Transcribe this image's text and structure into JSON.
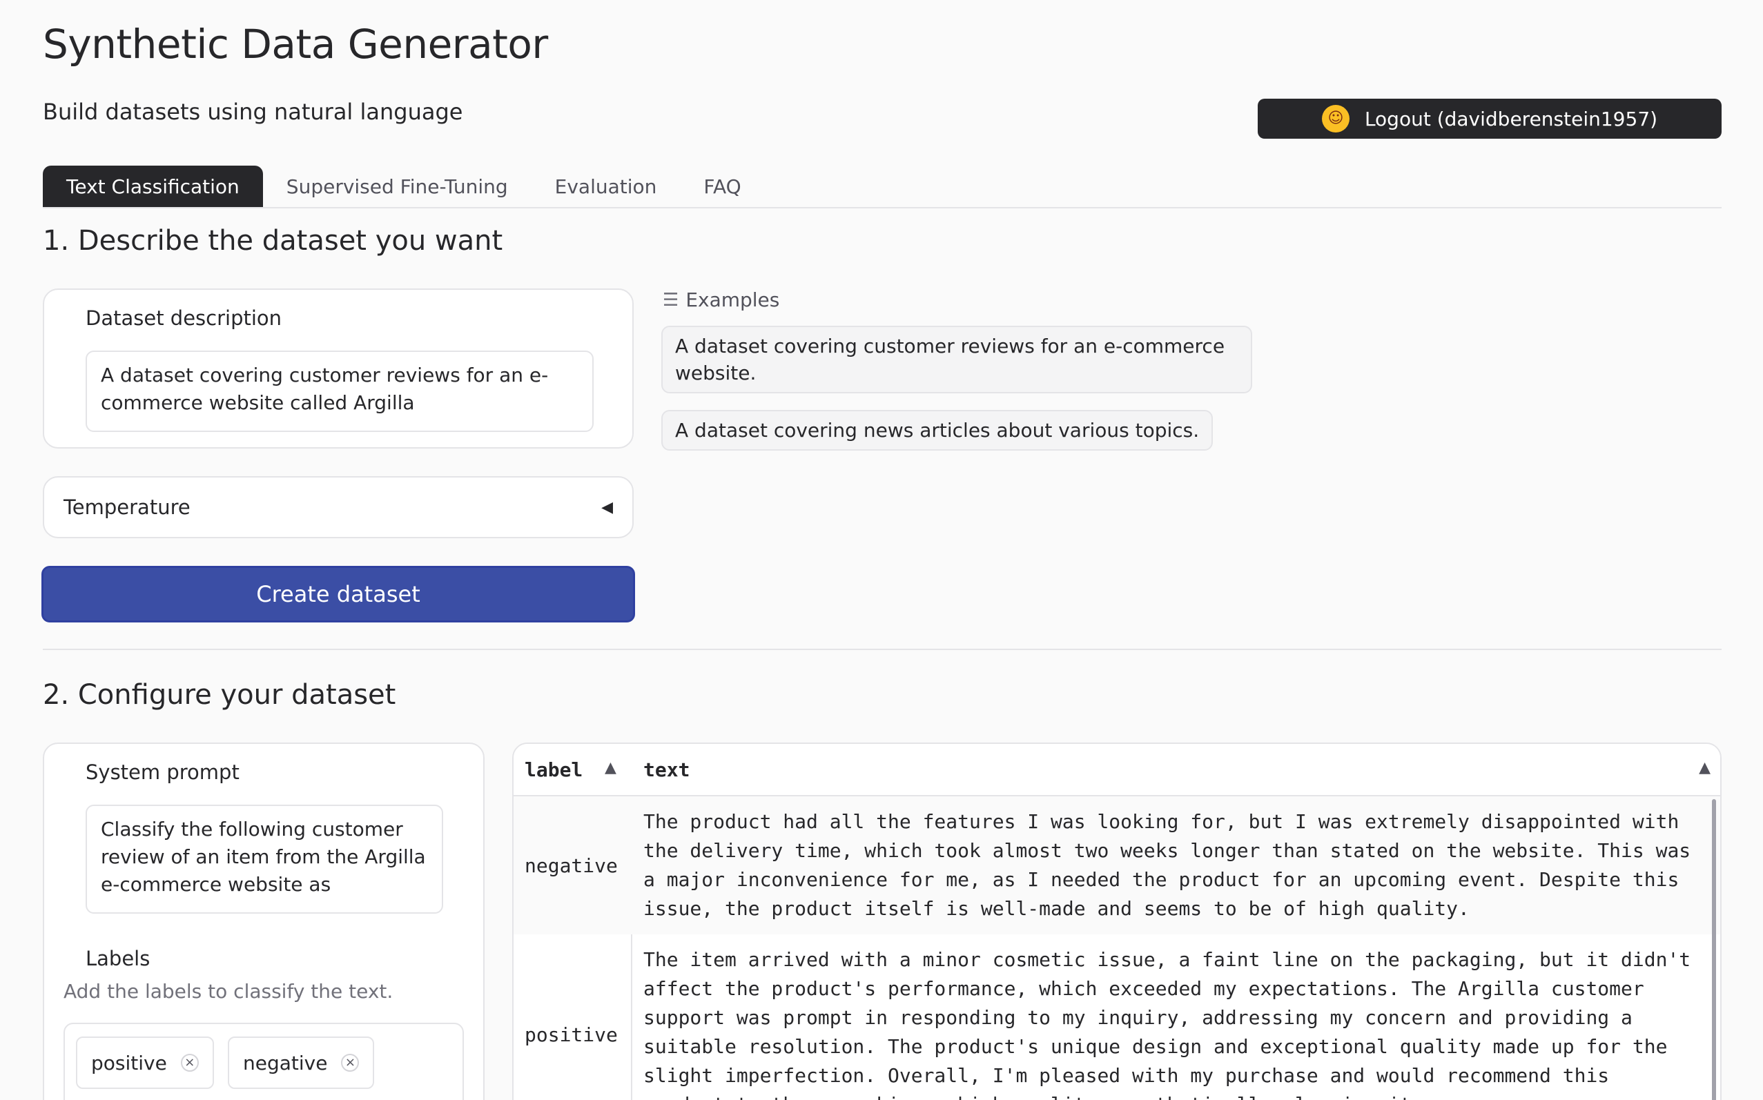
{
  "app": {
    "title": "Synthetic Data Generator",
    "subtitle": "Build datasets using natural language",
    "logout_label": "Logout (davidberenstein1957)"
  },
  "tabs": [
    {
      "label": "Text Classification",
      "active": true
    },
    {
      "label": "Supervised Fine-Tuning",
      "active": false
    },
    {
      "label": "Evaluation",
      "active": false
    },
    {
      "label": "FAQ",
      "active": false
    }
  ],
  "section1": {
    "heading": "1. Describe the dataset you want",
    "description_label": "Dataset description",
    "description_value": "A dataset covering customer reviews for an e-commerce website called Argilla",
    "examples_label": "Examples",
    "examples": [
      "A dataset covering customer reviews for an e-commerce website.",
      "A dataset covering news articles about various topics."
    ],
    "temperature_label": "Temperature",
    "create_button": "Create dataset"
  },
  "section2": {
    "heading": "2. Configure your dataset",
    "system_prompt_label": "System prompt",
    "system_prompt_value": "Classify the following customer review of an item from the Argilla e-commerce website as",
    "labels_label": "Labels",
    "labels_helper": "Add the labels to classify the text.",
    "labels": [
      "positive",
      "negative"
    ]
  },
  "table": {
    "columns": [
      "label",
      "text"
    ],
    "rows": [
      {
        "label": "negative",
        "text": "The product had all the features I was looking for, but I was extremely disappointed with the delivery time, which took almost two weeks longer than stated on the website. This was a major inconvenience for me, as I needed the product for an upcoming event. Despite this issue, the product itself is well-made and seems to be of high quality."
      },
      {
        "label": "positive",
        "text": "The item arrived with a minor cosmetic issue, a faint line on the packaging, but it didn't affect the product's performance, which exceeded my expectations. The Argilla customer support was prompt in responding to my inquiry, addressing my concern and providing a suitable resolution. The product's unique design and exceptional quality made up for the slight imperfection. Overall, I'm pleased with my purchase and would recommend this product to those seeking a high-quality, aesthetically pleasing item."
      }
    ]
  },
  "colors": {
    "primary": "#3b4ea5",
    "dark": "#27272a",
    "border": "#e4e4e7"
  }
}
